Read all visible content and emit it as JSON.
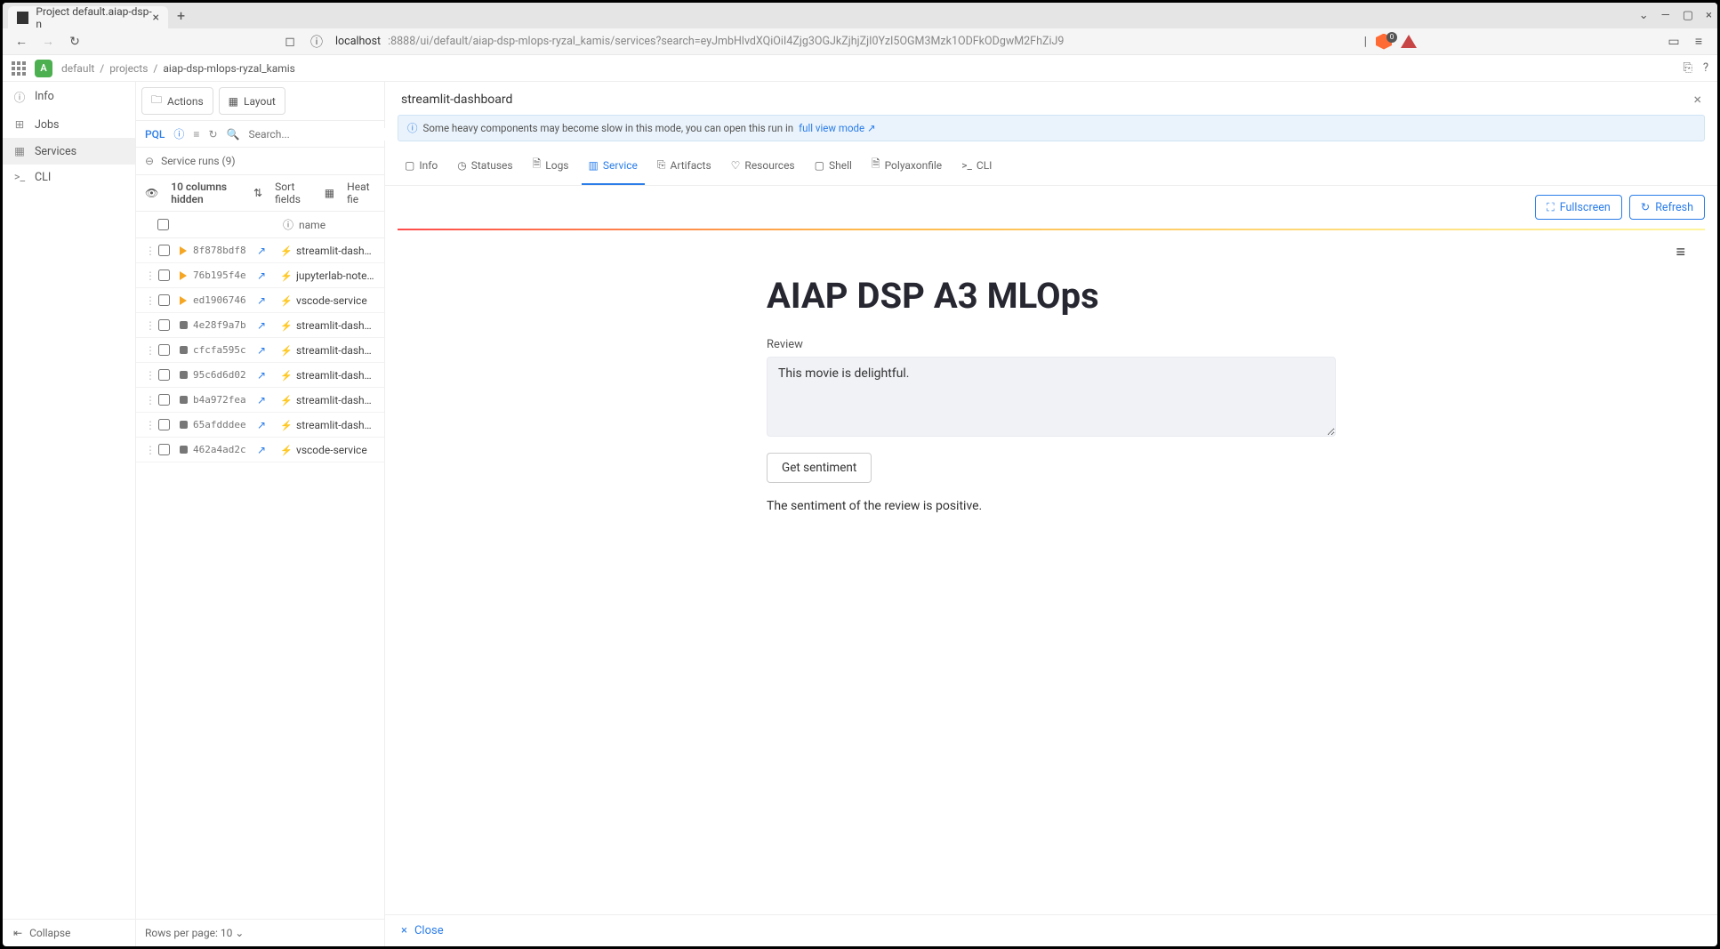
{
  "browser": {
    "tab_title": "Project default.aiap-dsp-n",
    "url_host": "localhost",
    "url_path": ":8888/ui/default/aiap-dsp-mlops-ryzal_kamis/services?search=eyJmbHlvdXQiOiI4Zjg3OGJkZjhjZjI0YzI5OGM3Mzk1ODFkODgwM2FhZiJ9",
    "shield_count": "0"
  },
  "header": {
    "org_initial": "A",
    "breadcrumb": [
      "default",
      "projects",
      "aiap-dsp-mlops-ryzal_kamis"
    ]
  },
  "leftnav": {
    "items": [
      {
        "icon": "ⓘ",
        "label": "Info"
      },
      {
        "icon": "⊞",
        "label": "Jobs"
      },
      {
        "icon": "▦",
        "label": "Services",
        "active": true
      },
      {
        "icon": ">_",
        "label": "CLI"
      }
    ],
    "collapse": "Collapse"
  },
  "listpanel": {
    "actions": "Actions",
    "layout": "Layout",
    "pql": "PQL",
    "search_placeholder": "Search...",
    "crumb_label": "Service runs (9)",
    "cols_hidden": "10 columns hidden",
    "sort_fields": "Sort fields",
    "heat_fields": "Heat fie",
    "col_name": "name",
    "rows": [
      {
        "status": "running",
        "id": "8f878bdf8",
        "kind": "bolt",
        "name": "streamlit-dashboard"
      },
      {
        "status": "running",
        "id": "76b195f4e",
        "kind": "bolt",
        "name": "jupyterlab-notebook"
      },
      {
        "status": "running",
        "id": "ed1906746",
        "kind": "bolt",
        "name": "vscode-service"
      },
      {
        "status": "stopped",
        "id": "4e28f9a7b",
        "kind": "bolt",
        "name": "streamlit-dashboard"
      },
      {
        "status": "stopped",
        "id": "cfcfa595c",
        "kind": "bolt",
        "name": "streamlit-dashboard"
      },
      {
        "status": "stopped",
        "id": "95c6d6d02",
        "kind": "bolt",
        "name": "streamlit-dashboard"
      },
      {
        "status": "stopped",
        "id": "b4a972fea",
        "kind": "bolt",
        "name": "streamlit-dashboard"
      },
      {
        "status": "stopped",
        "id": "65afdddee",
        "kind": "bolt",
        "name": "streamlit-dashboard"
      },
      {
        "status": "stopped",
        "id": "462a4ad2c",
        "kind": "bolt",
        "name": "vscode-service"
      }
    ],
    "rows_per_page": "Rows per page: 10"
  },
  "detail": {
    "title": "streamlit-dashboard",
    "banner_text": "Some heavy components may become slow in this mode, you can open this run in ",
    "banner_link": "full view mode",
    "tabs": [
      "Info",
      "Statuses",
      "Logs",
      "Service",
      "Artifacts",
      "Resources",
      "Shell",
      "Polyaxonfile",
      "CLI"
    ],
    "active_tab": "Service",
    "fullscreen": "Fullscreen",
    "refresh": "Refresh",
    "close": "Close"
  },
  "streamlit": {
    "title": "AIAP DSP A3 MLOps",
    "review_label": "Review",
    "review_value": "This movie is delightful.",
    "button": "Get sentiment",
    "result": "The sentiment of the review is positive."
  }
}
